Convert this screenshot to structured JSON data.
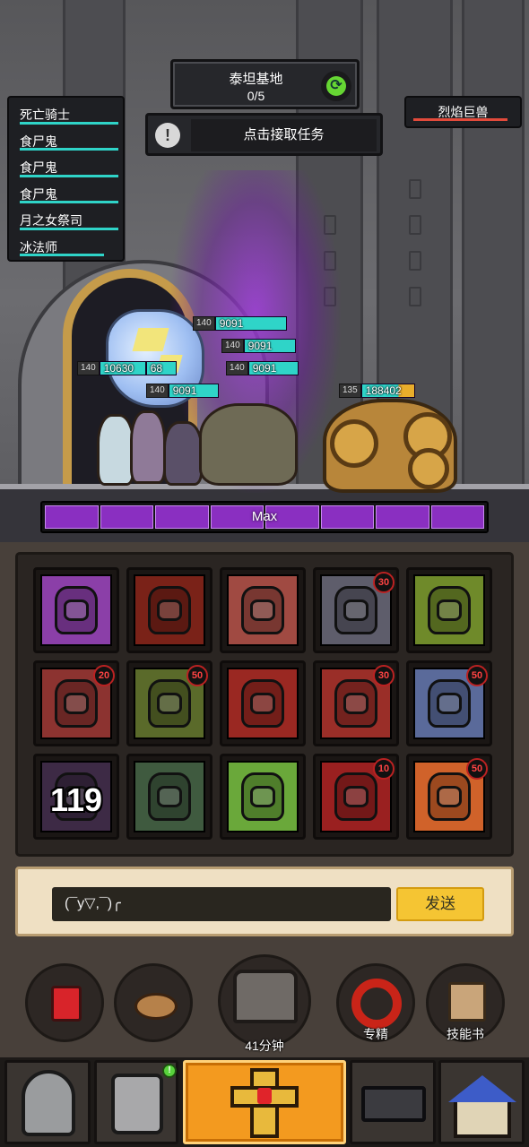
{
  "quest": {
    "title": "泰坦基地",
    "progress": "0/5"
  },
  "task": {
    "label": "点击接取任务"
  },
  "party": [
    {
      "name": "死亡骑士",
      "hp": 1.0
    },
    {
      "name": "食尸鬼",
      "hp": 1.0
    },
    {
      "name": "食尸鬼",
      "hp": 1.0
    },
    {
      "name": "食尸鬼",
      "hp": 1.0
    },
    {
      "name": "月之女祭司",
      "hp": 1.0
    },
    {
      "name": "冰法师",
      "hp": 0.85
    }
  ],
  "enemy": {
    "name": "烈焰巨兽",
    "hp": 0.95
  },
  "hp_bars": [
    {
      "level": "140",
      "value": "9091"
    },
    {
      "level": "140",
      "value": "9091"
    },
    {
      "level": "140",
      "value": "9091"
    },
    {
      "level": "140",
      "value": "10630",
      "extra": "68"
    },
    {
      "level": "140",
      "value": "9091"
    },
    {
      "level": "135",
      "value": "188402"
    }
  ],
  "rage": {
    "label": "Max",
    "segments": 8
  },
  "skills": [
    {
      "name": "purple-storm-skill",
      "color": "#8b3fa8",
      "badge": ""
    },
    {
      "name": "dark-knight-skill",
      "color": "#7a2218",
      "badge": ""
    },
    {
      "name": "red-burst-skill",
      "color": "#a04a42",
      "badge": ""
    },
    {
      "name": "skull-armor-skill",
      "color": "#5e5d6b",
      "badge": "30"
    },
    {
      "name": "green-helm-skill",
      "color": "#6f8a2a",
      "badge": ""
    },
    {
      "name": "rose-skill",
      "color": "#8c3330",
      "badge": "20"
    },
    {
      "name": "green-skull-skill",
      "color": "#5a6a2a",
      "badge": "50"
    },
    {
      "name": "blood-shield-skill",
      "color": "#9a2822",
      "badge": ""
    },
    {
      "name": "iron-claw-skill",
      "color": "#9a2e28",
      "badge": "30"
    },
    {
      "name": "arcane-spear-skill",
      "color": "#5a6a9a",
      "badge": "50"
    },
    {
      "name": "shadow-skill",
      "color": "#3d2a45",
      "badge": "",
      "cooldown": "119"
    },
    {
      "name": "dark-hand-skill",
      "color": "#3f5a3f",
      "badge": ""
    },
    {
      "name": "scarecrow-skill",
      "color": "#6aa83a",
      "badge": ""
    },
    {
      "name": "chain-blade-skill",
      "color": "#9a2020",
      "badge": "10"
    },
    {
      "name": "golden-spear-skill",
      "color": "#d0622a",
      "badge": "50"
    }
  ],
  "chat": {
    "input_value": "(¯y▽,¯)╭",
    "send_label": "发送"
  },
  "actions": {
    "potion_icon": "red-potion-icon",
    "bread_icon": "bread-icon",
    "chest_timer": "41分钟",
    "mastery_label": "专精",
    "skillbook_label": "技能书"
  },
  "nav": {
    "tabs": [
      "helmet-icon",
      "armor-icon",
      "cross-relic-icon",
      "anvil-icon",
      "house-icon"
    ],
    "active": 2,
    "notification": "!"
  },
  "colors": {
    "accent": "#f39a1f",
    "hp": "#2fd4c8",
    "rage": "#8a2fc1",
    "send": "#f5c533"
  }
}
